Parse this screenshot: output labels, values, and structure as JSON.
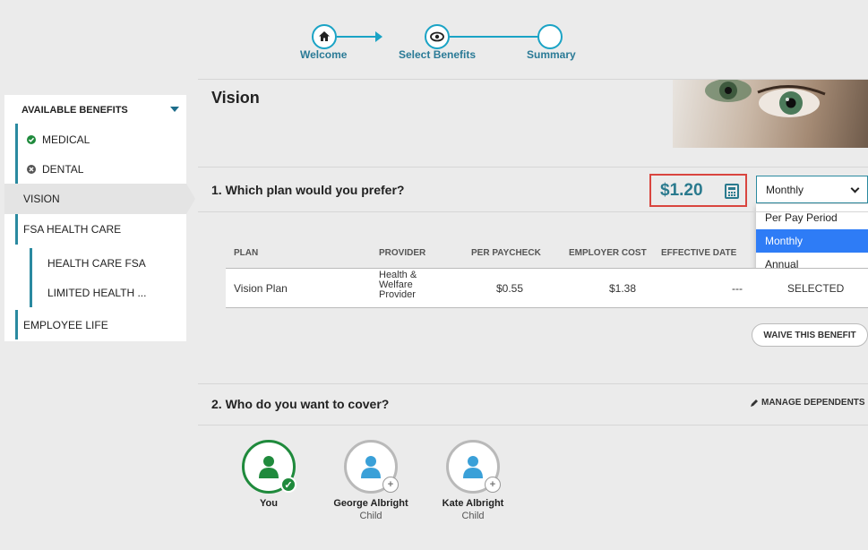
{
  "stepper": {
    "steps": [
      {
        "label": "Welcome",
        "icon": "home-icon"
      },
      {
        "label": "Select Benefits",
        "icon": "eye-icon"
      },
      {
        "label": "Summary",
        "icon": "empty-circle"
      }
    ],
    "accent": "#1aa3c5"
  },
  "sidebar": {
    "header": "AVAILABLE BENEFITS",
    "items": [
      {
        "label": "MEDICAL",
        "status": "complete"
      },
      {
        "label": "DENTAL",
        "status": "waived"
      },
      {
        "label": "VISION",
        "status": "active"
      },
      {
        "label": "FSA HEALTH CARE"
      },
      {
        "label": "HEALTH CARE FSA"
      },
      {
        "label": "LIMITED HEALTH ..."
      },
      {
        "label": "EMPLOYEE LIFE"
      }
    ]
  },
  "main": {
    "title": "Vision",
    "question1": "1. Which plan would you prefer?",
    "price": "$1.20",
    "frequency": {
      "selected": "Monthly",
      "options": [
        "Per Pay Period",
        "Monthly",
        "Annual"
      ]
    },
    "table": {
      "headers": [
        "PLAN",
        "PROVIDER",
        "PER PAYCHECK",
        "EMPLOYER COST",
        "EFFECTIVE DATE"
      ],
      "row": {
        "plan": "Vision Plan",
        "provider": [
          "Health &",
          "Welfare",
          "Provider"
        ],
        "per_paycheck": "$0.55",
        "employer_cost": "$1.38",
        "effective_date": "---",
        "status": "SELECTED"
      }
    },
    "waive_label": "WAIVE THIS BENEFIT",
    "question2": "2. Who do you want to cover?",
    "manage_label": "MANAGE DEPENDENTS",
    "people": [
      {
        "name": "You",
        "role": "",
        "selected": true
      },
      {
        "name": "George Albright",
        "role": "Child",
        "selected": false
      },
      {
        "name": "Kate Albright",
        "role": "Child",
        "selected": false
      }
    ]
  },
  "colors": {
    "teal": "#2a7a8e",
    "green": "#1f8a3c",
    "highlight_red": "#d9453f",
    "selected_blue": "#2e7cf6",
    "person_icon_blue": "#3aa0d8"
  }
}
